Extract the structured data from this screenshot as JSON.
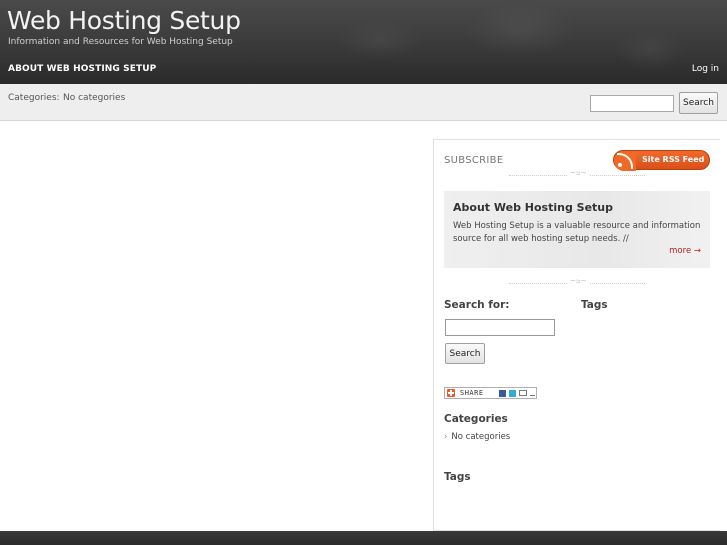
{
  "header": {
    "title": "Web Hosting Setup",
    "tagline": "Information and Resources for Web Hosting Setup",
    "nav_about": "About Web Hosting Setup",
    "nav_login": "Log in"
  },
  "catbar": {
    "label": "Categories:",
    "value": "No categories",
    "search_button": "Search"
  },
  "sidebar": {
    "subscribe": "SUBSCRIBE",
    "rss_label": "Site RSS Feed",
    "divider_glyph": "~ಜ~",
    "about": {
      "title": "About Web Hosting Setup",
      "text": "Web Hosting Setup is a valuable resource and information source for all web hosting setup needs. //",
      "more": "more →"
    },
    "search_for": "Search for:",
    "tags_label": "Tags",
    "search_button": "Search",
    "share_label": "SHARE",
    "categories_title": "Categories",
    "categories_item": "No categories",
    "tags_title": "Tags"
  },
  "colors": {
    "header_bg": "#3a3a3a",
    "rss_orange": "#e8582a",
    "more_link": "#b22222"
  }
}
